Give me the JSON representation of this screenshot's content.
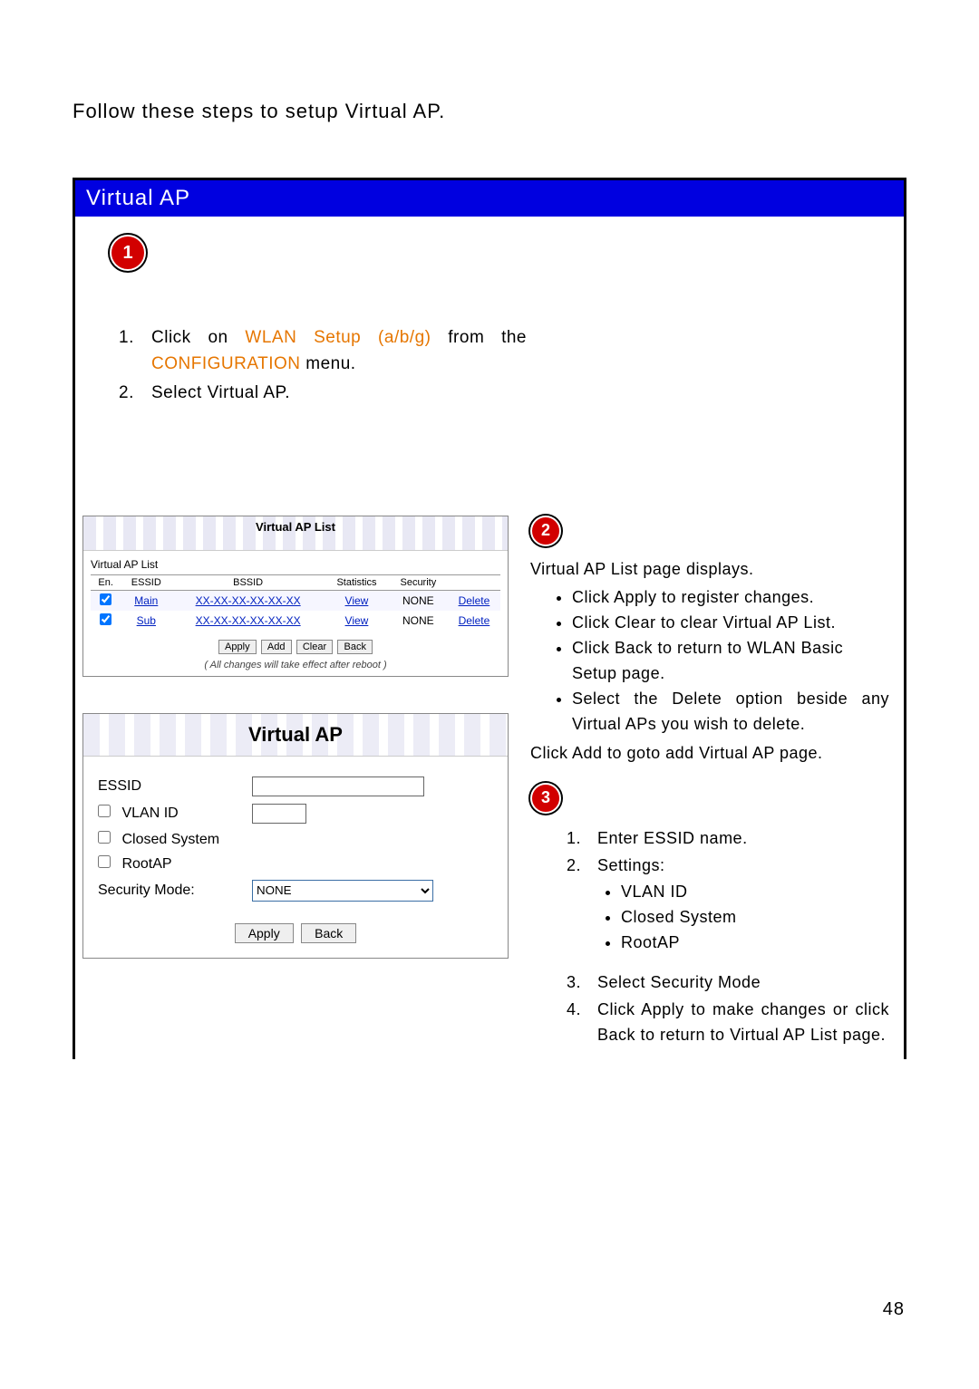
{
  "intro": "Follow these steps to setup Virtual AP.",
  "header_title": "Virtual AP",
  "badges": {
    "b1": "1",
    "b2": "2",
    "b3": "3"
  },
  "steps1": {
    "n1": "1.",
    "n2": "2.",
    "t1a": "Click on ",
    "t1b": "WLAN Setup (a/b/g)",
    "t1c": " from the ",
    "t1d": "CONFIGURATION",
    "t1e": " menu.",
    "t2": "Select Virtual AP."
  },
  "vap_list": {
    "panel_title": "Virtual AP List",
    "subtitle": "Virtual AP List",
    "headers": [
      "En.",
      "ESSID",
      "BSSID",
      "Statistics",
      "Security",
      ""
    ],
    "rows": [
      {
        "en": true,
        "essid": "Main",
        "bssid": "XX-XX-XX-XX-XX-XX",
        "stat": "View",
        "sec": "NONE",
        "action": "Delete"
      },
      {
        "en": true,
        "essid": "Sub",
        "bssid": "XX-XX-XX-XX-XX-XX",
        "stat": "View",
        "sec": "NONE",
        "action": "Delete"
      }
    ],
    "buttons": {
      "apply": "Apply",
      "add": "Add",
      "clear": "Clear",
      "back": "Back"
    },
    "note": "( All changes will take effect after reboot )"
  },
  "vap_form": {
    "title": "Virtual AP",
    "labels": {
      "essid": "ESSID",
      "vlan": "VLAN ID",
      "closed": "Closed System",
      "root": "RootAP",
      "secmode": "Security Mode:"
    },
    "values": {
      "essid": "",
      "vlan": ""
    },
    "secmode_selected": "NONE",
    "buttons": {
      "apply": "Apply",
      "back": "Back"
    }
  },
  "right2": {
    "lead": "Virtual AP List page displays.",
    "bullets": [
      "Click Apply to register changes.",
      "Click Clear to clear Virtual AP List.",
      "Click Back to return to WLAN Basic Setup page.",
      "Select the Delete option beside any Virtual APs you wish to delete."
    ],
    "tail": "Click Add to goto add Virtual AP page."
  },
  "right3": {
    "items": [
      {
        "n": "1.",
        "t": "Enter ESSID name."
      },
      {
        "n": "2.",
        "t": "Settings:"
      }
    ],
    "sub_bullets": [
      "VLAN ID",
      "Closed System",
      "RootAP"
    ],
    "items2": [
      {
        "n": "3.",
        "t": "Select Security Mode"
      },
      {
        "n": "4.",
        "t": "Click Apply to make changes or click Back to return to Virtual AP List page."
      }
    ]
  },
  "page_number": "48"
}
